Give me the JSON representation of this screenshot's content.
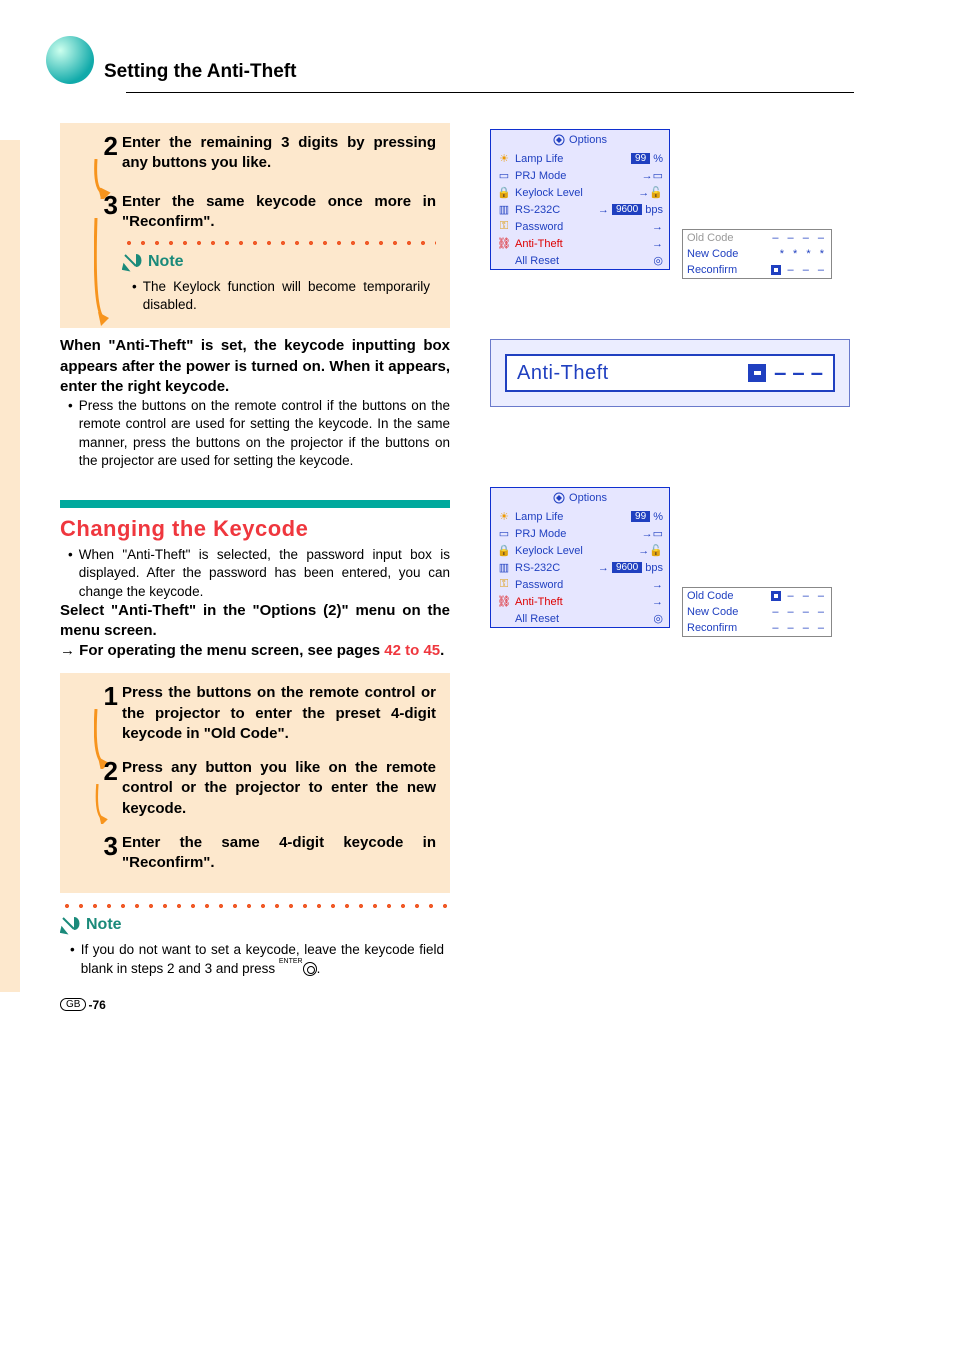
{
  "header": {
    "title": "Setting the Anti-Theft"
  },
  "topBlock": {
    "step2": {
      "num": "2",
      "text": "Enter the remaining 3 digits by pressing any buttons you like."
    },
    "step3": {
      "num": "3",
      "text": "Enter the same keycode once more in \"Reconfirm\"."
    },
    "noteLabel": "Note",
    "noteText": "The Keylock function will become temporarily disabled."
  },
  "midPara": {
    "bold": "When \"Anti-Theft\" is set, the keycode inputting box appears after the power is turned on. When it appears, enter the right keycode.",
    "bullet": "Press the buttons on the remote control if the buttons on the remote control are used for setting the keycode. In the same manner, press the buttons on the projector if the buttons on the projector are used for setting the keycode."
  },
  "section2": {
    "title": "Changing the Keycode",
    "intro": "When \"Anti-Theft\" is selected, the password input box is displayed. After the password has been entered, you can change the keycode.",
    "select": "Select \"Anti-Theft\" in the \"Options (2)\" menu on the menu screen.",
    "operPrefix": "→ For operating the menu screen, see pages ",
    "pageLink": "42 to 45",
    "operSuffix": ".",
    "step1": {
      "num": "1",
      "text": "Press the buttons on the remote control or the projector to enter the preset 4-digit keycode in \"Old Code\"."
    },
    "step2": {
      "num": "2",
      "text": "Press any button you like on the remote control or the projector to enter the new keycode."
    },
    "step3": {
      "num": "3",
      "text": "Enter the same 4-digit keycode in \"Reconfirm\"."
    },
    "noteLabel": "Note",
    "noteText": "If you do not want to set a keycode, leave the keycode field blank in steps 2 and 3 and press "
  },
  "osd1": {
    "title": "Options",
    "rows": {
      "lamp": {
        "label": "Lamp Life",
        "value": "99",
        "unit": "%"
      },
      "prj": {
        "label": "PRJ Mode"
      },
      "keylock": {
        "label": "Keylock Level"
      },
      "rs": {
        "label": "RS-232C",
        "value": "9600",
        "unit": "bps"
      },
      "pwd": {
        "label": "Password"
      },
      "anti": {
        "label": "Anti-Theft"
      },
      "reset": {
        "label": "All Reset"
      }
    }
  },
  "codebox1": {
    "old": {
      "label": "Old Code",
      "value": "– – – –"
    },
    "new": {
      "label": "New Code",
      "value": "* * * *"
    },
    "re": {
      "label": "Reconfirm",
      "value": "– – –"
    }
  },
  "antiBox": {
    "label": "Anti-Theft",
    "dashes": "– – –"
  },
  "codebox2": {
    "old": {
      "label": "Old Code",
      "value": "– – –"
    },
    "new": {
      "label": "New Code",
      "value": "– – – –"
    },
    "re": {
      "label": "Reconfirm",
      "value": "– – – –"
    }
  },
  "footer": {
    "gb": "GB",
    "page": "-76"
  }
}
